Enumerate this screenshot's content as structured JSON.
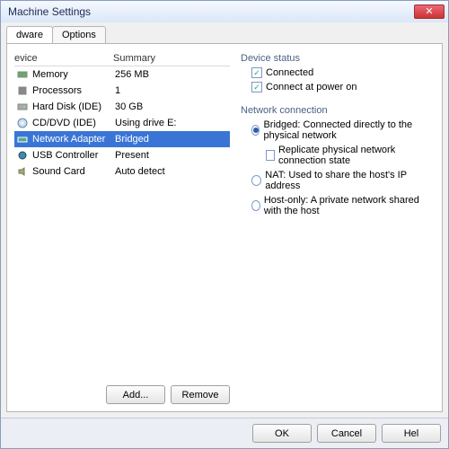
{
  "window": {
    "title": "Machine Settings"
  },
  "tabs": {
    "hardware": "dware",
    "options": "Options"
  },
  "headers": {
    "device": "evice",
    "summary": "Summary"
  },
  "devices": [
    {
      "name": "Memory",
      "summary": "256 MB",
      "icon": "memory",
      "selected": false
    },
    {
      "name": "Processors",
      "summary": "1",
      "icon": "cpu",
      "selected": false
    },
    {
      "name": "Hard Disk (IDE)",
      "summary": "30 GB",
      "icon": "hdd",
      "selected": false
    },
    {
      "name": "CD/DVD (IDE)",
      "summary": "Using drive E:",
      "icon": "cd",
      "selected": false
    },
    {
      "name": "Network Adapter",
      "summary": "Bridged",
      "icon": "net",
      "selected": true
    },
    {
      "name": "USB Controller",
      "summary": "Present",
      "icon": "usb",
      "selected": false
    },
    {
      "name": "Sound Card",
      "summary": "Auto detect",
      "icon": "sound",
      "selected": false
    }
  ],
  "buttons": {
    "add": "Add...",
    "remove": "Remove",
    "ok": "OK",
    "cancel": "Cancel",
    "help": "Hel"
  },
  "status": {
    "title": "Device status",
    "connected": "Connected",
    "connect_power": "Connect at power on"
  },
  "netconn": {
    "title": "Network connection",
    "bridged": "Bridged: Connected directly to the physical network",
    "replicate": "Replicate physical network connection state",
    "nat": "NAT: Used to share the host's IP address",
    "hostonly": "Host-only: A private network shared with the host"
  }
}
